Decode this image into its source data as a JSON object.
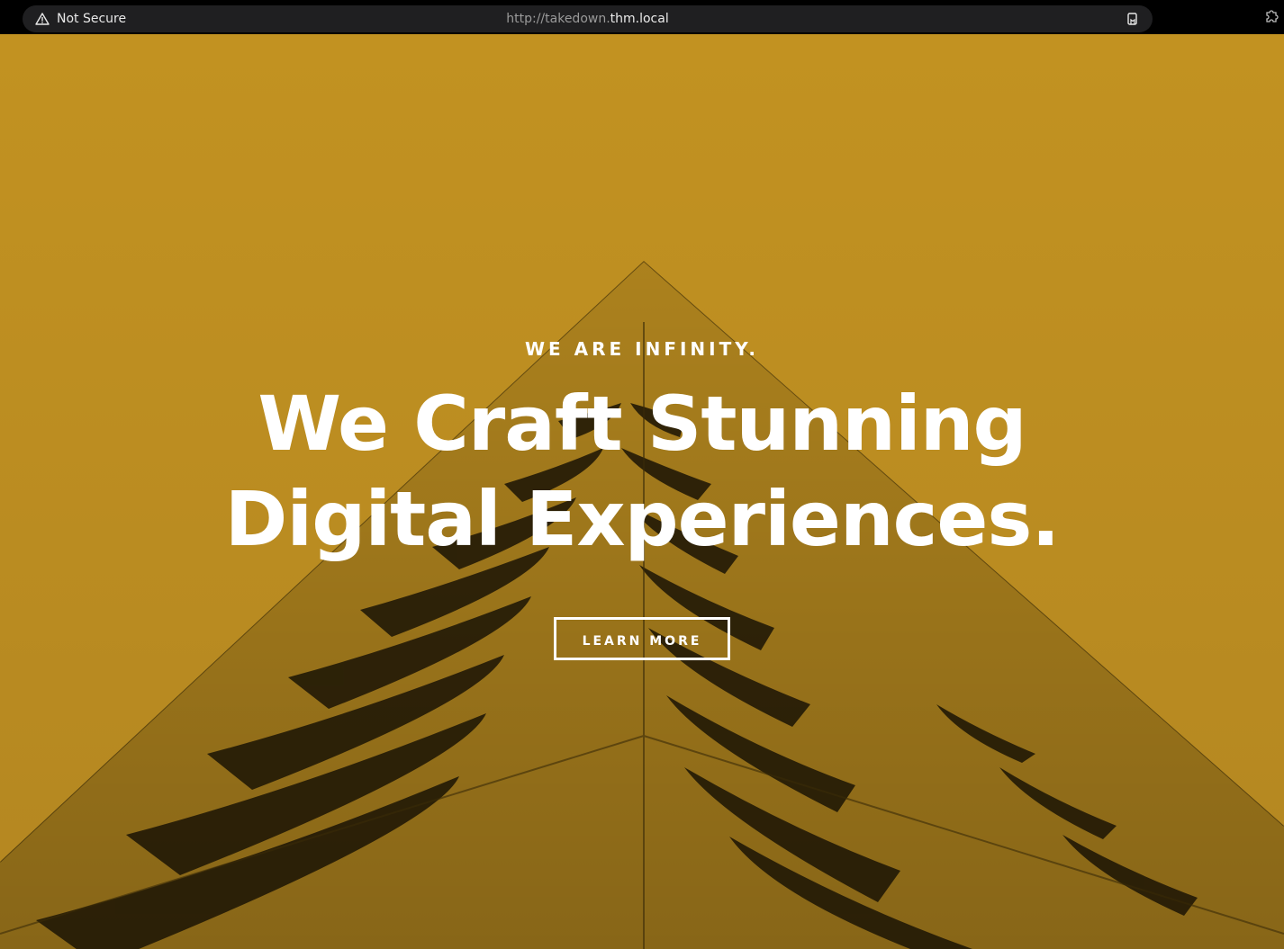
{
  "browser": {
    "security_label": "Not Secure",
    "url_prefix": "http://takedown.",
    "url_domain": "thm.local",
    "icons": [
      "warning-triangle-icon",
      "reader-mode-icon",
      "extension-puzzle-icon"
    ]
  },
  "hero": {
    "kicker": "WE ARE INFINITY.",
    "headline_line1": "We Craft Stunning",
    "headline_line2": "Digital Experiences.",
    "button_label": "LEARN MORE",
    "accent_color": "#c2901f"
  }
}
